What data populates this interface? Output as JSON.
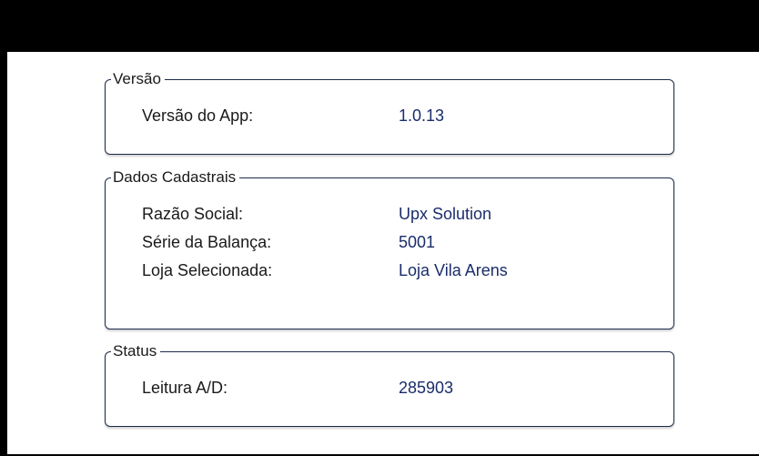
{
  "versao": {
    "title": "Versão",
    "rows": [
      {
        "label": "Versão do App:",
        "value": "1.0.13"
      }
    ]
  },
  "dados_cadastrais": {
    "title": "Dados Cadastrais",
    "rows": [
      {
        "label": "Razão Social:",
        "value": "Upx Solution"
      },
      {
        "label": "Série da Balança:",
        "value": "5001"
      },
      {
        "label": "Loja Selecionada:",
        "value": "Loja Vila Arens"
      }
    ]
  },
  "status": {
    "title": "Status",
    "rows": [
      {
        "label": "Leitura A/D:",
        "value": "285903"
      }
    ]
  },
  "colors": {
    "border": "#1c2b4a",
    "value_text": "#1a2d6b",
    "label_text": "#1a1a1a",
    "top_bar": "#000000"
  }
}
